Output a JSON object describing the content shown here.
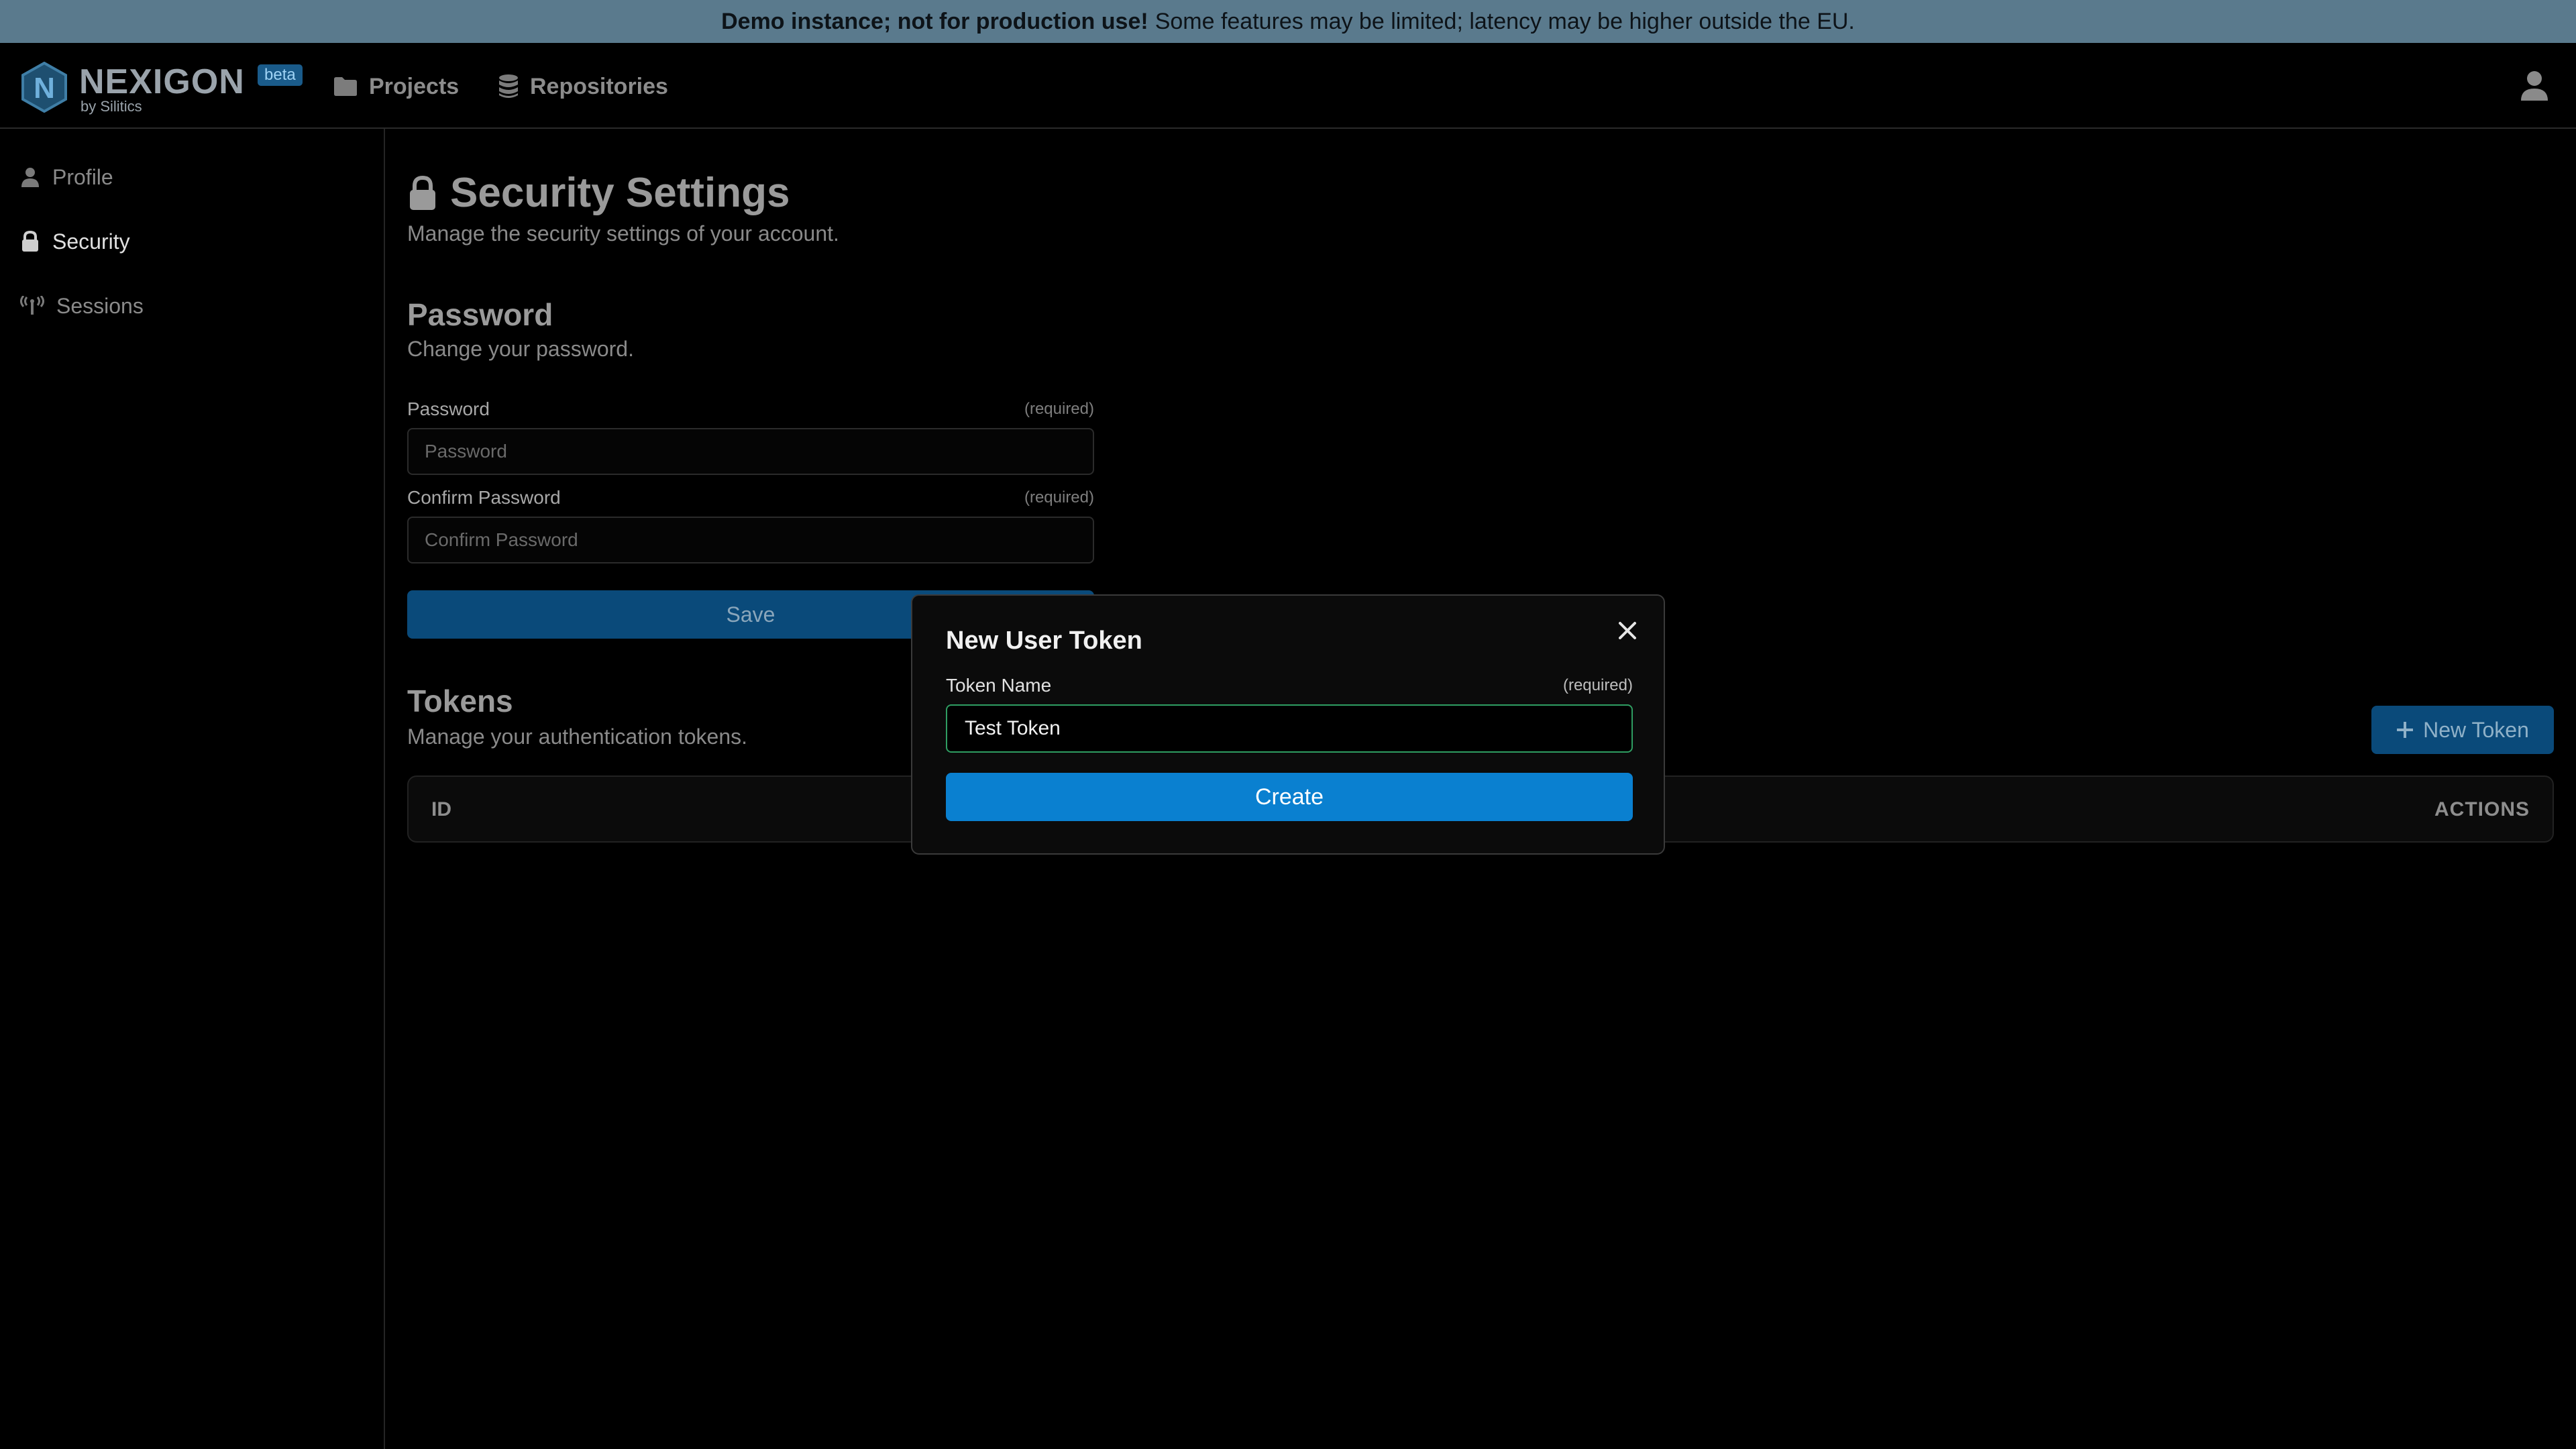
{
  "banner": {
    "bold": "Demo instance; not for production use!",
    "rest": "Some features may be limited; latency may be higher outside the EU."
  },
  "brand": {
    "name": "NEXIGON",
    "sub": "by Silitics",
    "badge": "beta",
    "logo_letter": "N",
    "logo_color": "#2c6e97"
  },
  "topnav": {
    "items": [
      {
        "label": "Projects",
        "icon": "folder-icon"
      },
      {
        "label": "Repositories",
        "icon": "database-icon"
      }
    ],
    "user_icon": "user-icon"
  },
  "sidebar": {
    "items": [
      {
        "label": "Profile",
        "icon": "user-icon",
        "active": false
      },
      {
        "label": "Security",
        "icon": "lock-icon",
        "active": true
      },
      {
        "label": "Sessions",
        "icon": "broadcast-icon",
        "active": false
      }
    ]
  },
  "page": {
    "title": "Security Settings",
    "subtitle": "Manage the security settings of your account."
  },
  "password": {
    "title": "Password",
    "subtitle": "Change your password.",
    "fields": [
      {
        "label": "Password",
        "required": "(required)",
        "placeholder": "Password"
      },
      {
        "label": "Confirm Password",
        "required": "(required)",
        "placeholder": "Confirm Password"
      }
    ],
    "save_label": "Save"
  },
  "tokens": {
    "title": "Tokens",
    "subtitle": "Manage your authentication tokens.",
    "new_label": "New Token",
    "columns": [
      "ID",
      "ACTIONS"
    ]
  },
  "modal": {
    "title": "New User Token",
    "field_label": "Token Name",
    "required": "(required)",
    "value": "Test Token",
    "submit_label": "Create"
  },
  "colors": {
    "accent": "#0a80d0",
    "accent_dim": "#0a4a7a",
    "focus_border": "#2f9e62",
    "banner_bg": "#5a7a8d"
  }
}
